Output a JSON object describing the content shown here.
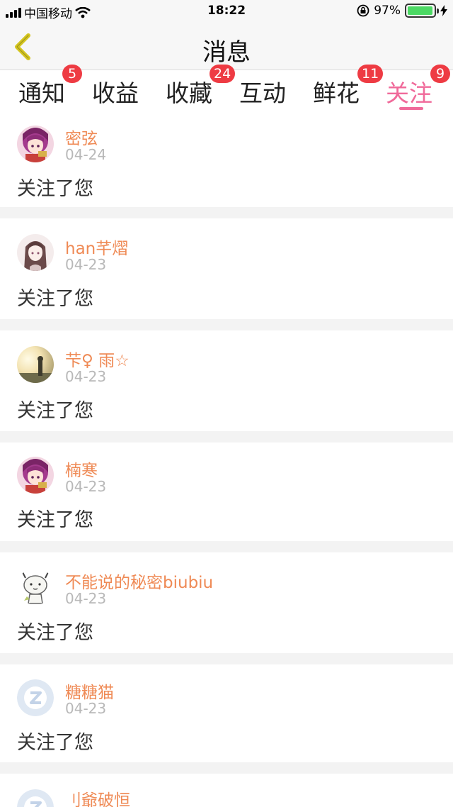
{
  "status_bar": {
    "carrier": "中国移动",
    "time": "18:22",
    "battery_percent": "97%",
    "battery_level": 0.97,
    "icons": [
      "signal-icon",
      "wifi-icon",
      "orientation-lock-icon",
      "battery-icon",
      "charging-icon"
    ]
  },
  "nav": {
    "title": "消息",
    "back_icon": "chevron-left-icon",
    "accent": "#d4c51e"
  },
  "tabs": [
    {
      "label": "通知",
      "badge": "5"
    },
    {
      "label": "收益",
      "badge": ""
    },
    {
      "label": "收藏",
      "badge": "24"
    },
    {
      "label": "互动",
      "badge": ""
    },
    {
      "label": "鲜花",
      "badge": "11"
    },
    {
      "label": "关注",
      "badge": "9",
      "active": true
    }
  ],
  "colors": {
    "active_tab": "#f06a9a",
    "badge": "#ee3b43",
    "username": "#ef8a55",
    "date": "#b8b8b8"
  },
  "items": [
    {
      "name": "密弦",
      "date": "04-24",
      "text": "关注了您",
      "avatar": "anime-girl-purple-avatar"
    },
    {
      "name": "han芊熠",
      "date": "04-23",
      "text": "关注了您",
      "avatar": "anime-girl-sketch-avatar"
    },
    {
      "name": "芐♀ 雨☆",
      "date": "04-23",
      "text": "关注了您",
      "avatar": "sunset-girl-avatar"
    },
    {
      "name": "楠寒",
      "date": "04-23",
      "text": "关注了您",
      "avatar": "anime-girl-purple-avatar"
    },
    {
      "name": "不能说的秘密biubiu",
      "date": "04-23",
      "text": "关注了您",
      "avatar": "cartoon-rabbit-avatar"
    },
    {
      "name": "糖糖猫",
      "date": "04-23",
      "text": "关注了您",
      "avatar": "default-z-avatar"
    },
    {
      "name": "刂爺破恒",
      "date": "",
      "text": "",
      "avatar": "default-z-avatar"
    }
  ]
}
